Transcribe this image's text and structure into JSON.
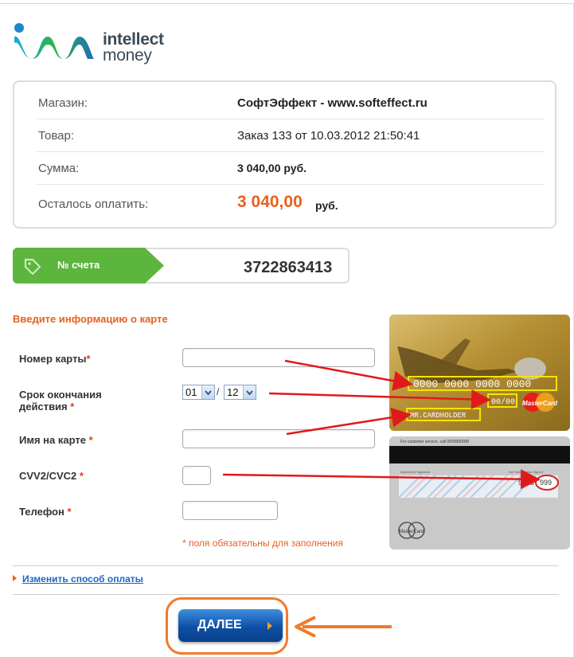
{
  "logo": {
    "line1": "intellect",
    "line2": "money"
  },
  "order": {
    "shop_label": "Магазин:",
    "shop_value": "СофтЭффект - www.softeffect.ru",
    "item_label": "Товар:",
    "item_value": "Заказ 133 от 10.03.2012 21:50:41",
    "sum_label": "Сумма:",
    "sum_value": "3 040,00 руб.",
    "remaining_label": "Осталось оплатить:",
    "remaining_amount": "3 040,00",
    "remaining_currency": "руб."
  },
  "account": {
    "label": "№ счета",
    "number": "3722863413"
  },
  "form": {
    "title": "Введите информацию о карте",
    "card_number_label": "Номер карты",
    "expiry_label_1": "Срок окончания",
    "expiry_label_2": "действия",
    "expiry_month": "01",
    "expiry_year": "12",
    "expiry_separator": "/",
    "name_label": "Имя на карте",
    "cvv_label": "CVV2/CVC2",
    "phone_label": "Телефон",
    "required_mark": "*",
    "required_note": "* поля обязательны для заполнения"
  },
  "card_image": {
    "number_mask": "0000 0000 0000 0000",
    "expiry_mask": "00/00",
    "holder_mask": "MR.CARDHOLDER",
    "brand": "MasterCard",
    "back_cvv_prefix": "9999",
    "back_cvv": "999",
    "back_service": "For customer service, call 0000000000",
    "back_signature": "Authorized Signature",
    "back_not_valid": "Not Valid Unless Signed"
  },
  "links": {
    "change_payment": "Изменить способ оплаты"
  },
  "button": {
    "next": "ДАЛЕЕ"
  },
  "colors": {
    "accent": "#e8601c",
    "green": "#5cb53c",
    "button": "#0e4fa6",
    "link": "#1b66c4"
  }
}
